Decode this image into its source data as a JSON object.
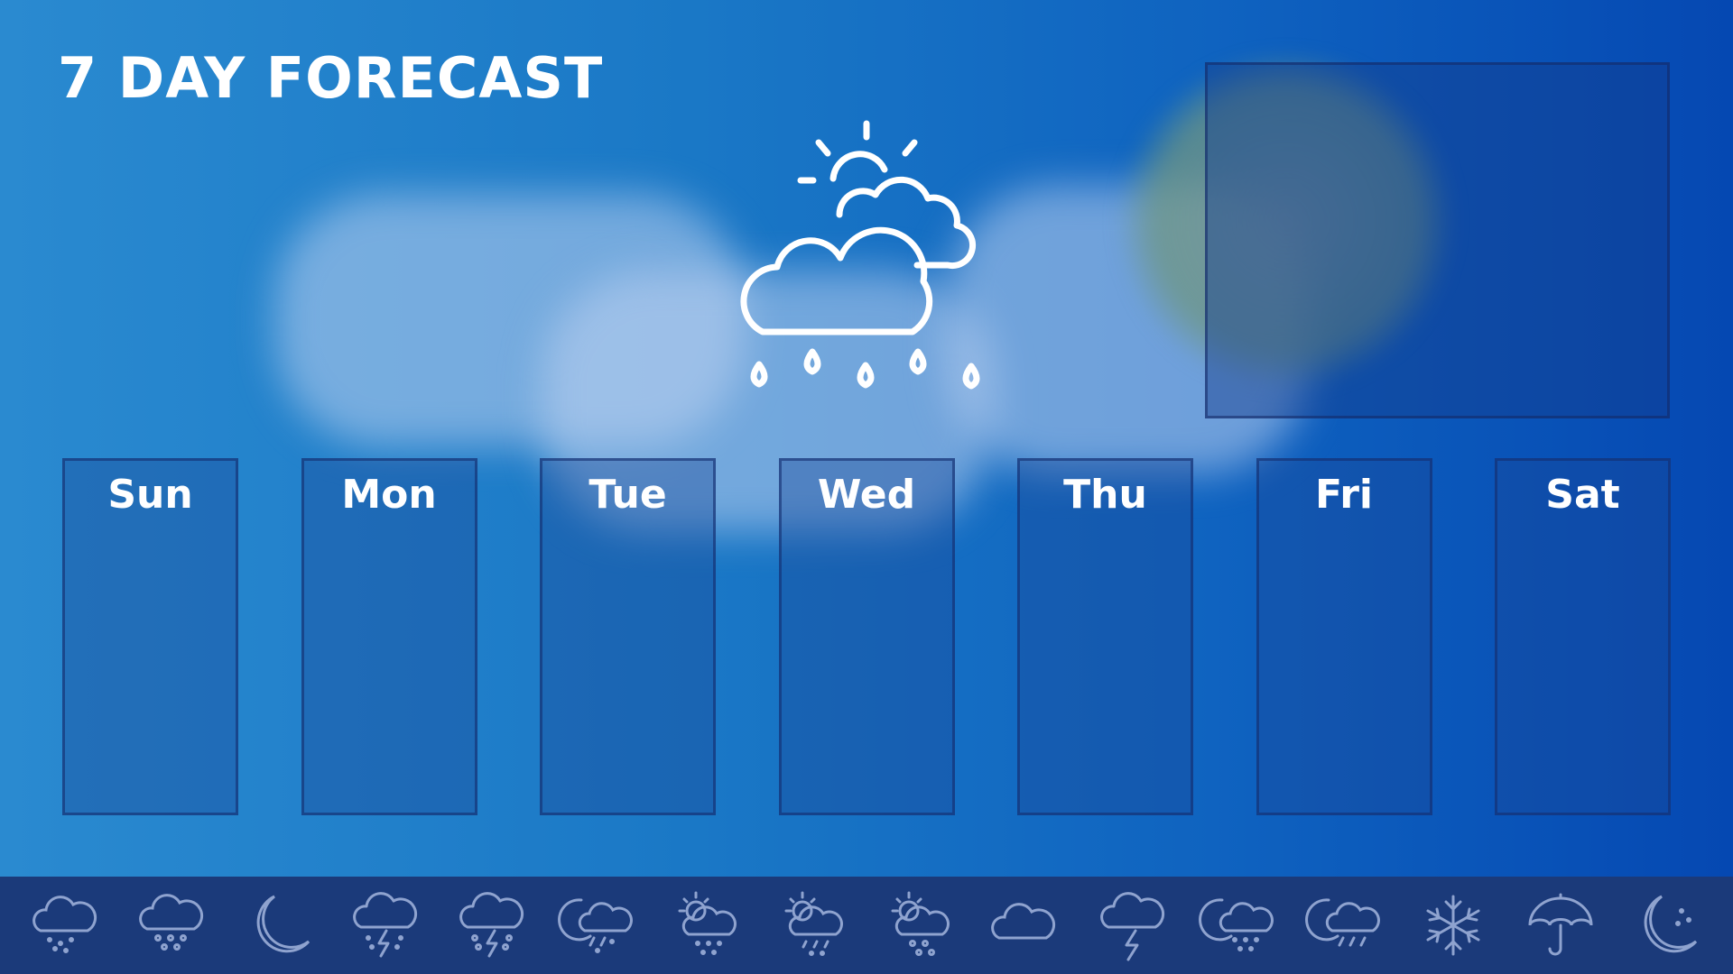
{
  "header": {
    "title": "7 DAY FORECAST"
  },
  "hero": {
    "icon": "sun-cloud-rain-icon"
  },
  "days": [
    {
      "label": "Sun"
    },
    {
      "label": "Mon"
    },
    {
      "label": "Tue"
    },
    {
      "label": "Wed"
    },
    {
      "label": "Thu"
    },
    {
      "label": "Fri"
    },
    {
      "label": "Sat"
    }
  ],
  "icon_bar": {
    "icons": [
      "cloud-snow-icon",
      "cloud-hail-icon",
      "crescent-moon-icon",
      "cloud-lightning-snow-icon",
      "cloud-lightning-hail-icon",
      "moon-cloud-sleet-icon",
      "sun-cloud-snow-icon",
      "sun-cloud-sleet-icon",
      "sun-cloud-hail-icon",
      "cloud-icon",
      "cloud-lightning-icon",
      "moon-cloud-snow-icon",
      "moon-cloud-rain-icon",
      "snowflake-icon",
      "umbrella-icon",
      "moon-stars-icon"
    ]
  },
  "colors": {
    "background_left": "#2a8ad0",
    "background_right": "#0548b2",
    "icon_bar_bg": "#1b3a7a",
    "icon_stroke": "#8fa3cf",
    "text": "#ffffff"
  }
}
